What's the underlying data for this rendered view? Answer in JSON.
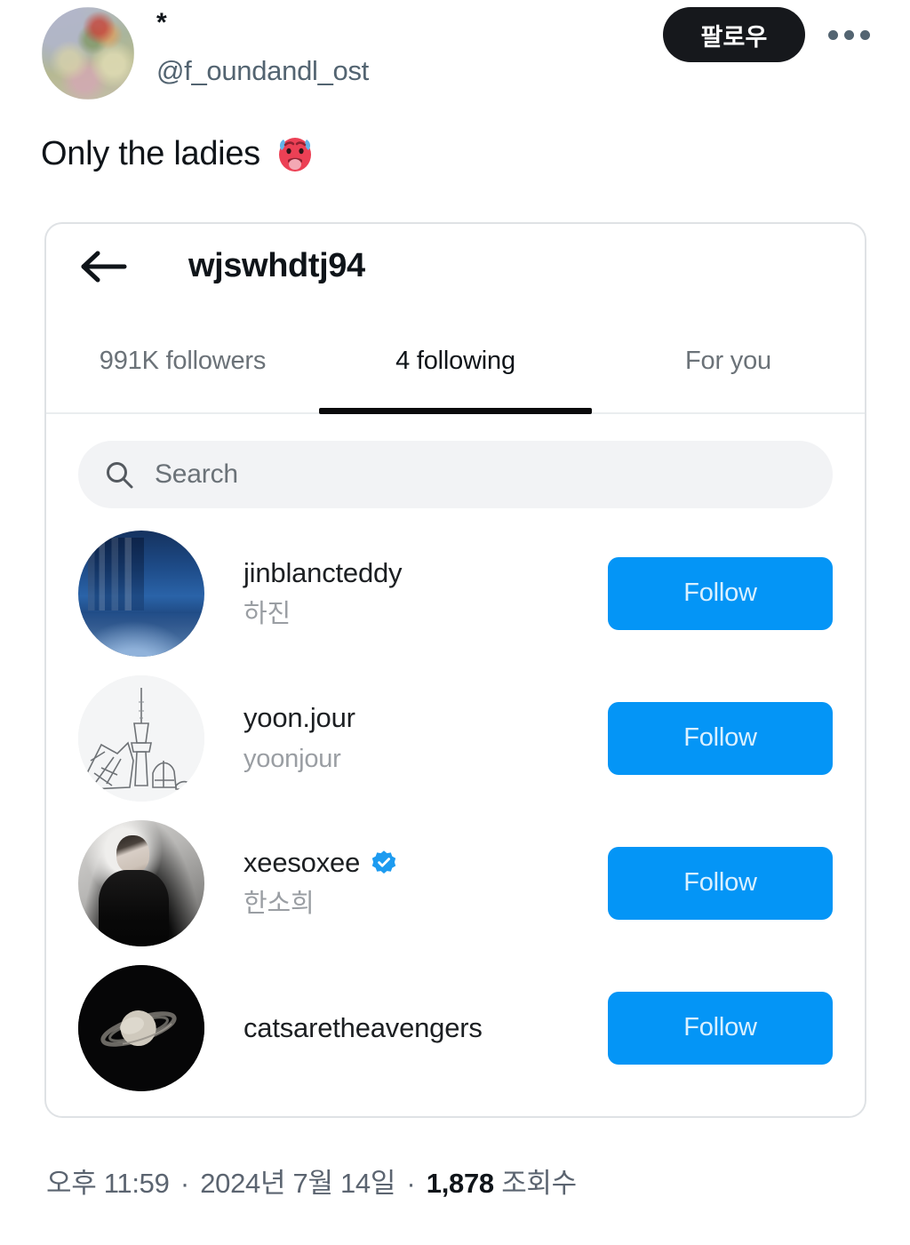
{
  "tweet": {
    "author": {
      "display_name": "*",
      "handle": "@f_oundandl_ost",
      "avatar_name": "impressionist-garden-painting"
    },
    "follow_button_label": "팔로우",
    "more_menu_label": "···",
    "text": "Only the ladies",
    "emoji": "hot-face",
    "footer": {
      "time": "오후 11:59",
      "separator_1": "·",
      "date": "2024년 7월 14일",
      "separator_2": "·",
      "views_count": "1,878",
      "views_label": "조회수"
    }
  },
  "embedded_card": {
    "back_label": "back-arrow",
    "title": "wjswhdtj94",
    "tabs": [
      {
        "label": "991K followers",
        "active": false
      },
      {
        "label": "4 following",
        "active": true
      },
      {
        "label": "For you",
        "active": false
      }
    ],
    "search": {
      "placeholder": "Search",
      "icon": "search-icon"
    },
    "follow_label": "Follow",
    "users": [
      {
        "username": "jinblancteddy",
        "subtitle": "하진",
        "verified": false,
        "avatar": "night-city-skyline",
        "action": "Follow"
      },
      {
        "username": "yoon.jour",
        "subtitle": "yoonjour",
        "verified": false,
        "avatar": "namsan-tower-sketch",
        "action": "Follow"
      },
      {
        "username": "xeesoxee",
        "subtitle": "한소희",
        "verified": true,
        "avatar": "black-and-white-portrait",
        "action": "Follow"
      },
      {
        "username": "catsaretheavengers",
        "subtitle": "",
        "verified": false,
        "avatar": "saturn-planet",
        "action": "Follow"
      }
    ]
  },
  "colors": {
    "follow_blue": "#0495F6",
    "follow_dark": "#16181C",
    "verified_blue": "#1D9BF0",
    "muted_text": "#6B7278",
    "sub_text": "#9A9EA3"
  }
}
